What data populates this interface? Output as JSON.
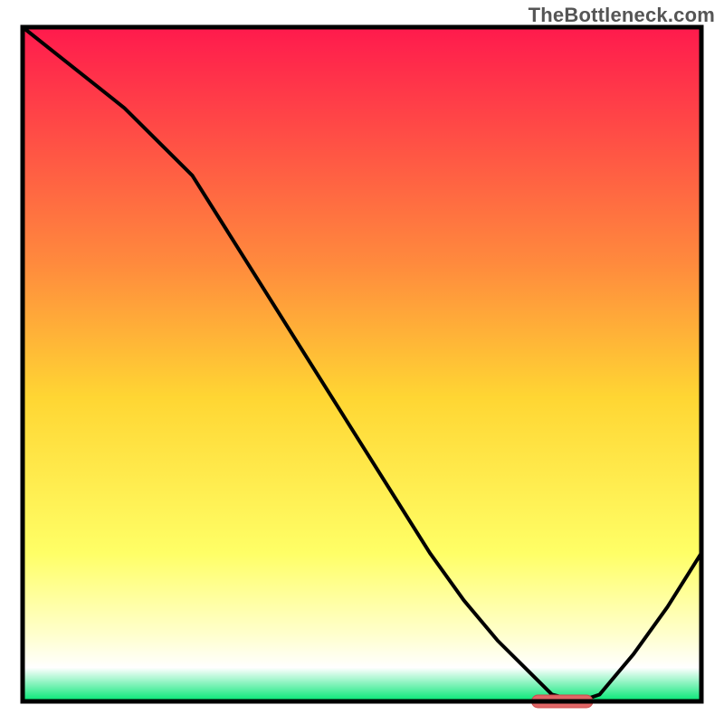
{
  "watermark": "TheBottleneck.com",
  "colors": {
    "border": "#000000",
    "curve": "#000000",
    "marker_fill": "#e06666",
    "marker_stroke": "#cc4b4b",
    "grad_top": "#ff1a4d",
    "grad_upper_mid": "#ff8a3d",
    "grad_mid": "#ffd633",
    "grad_lower_mid": "#ffff66",
    "grad_pale": "#ffffcc",
    "grad_white": "#ffffff",
    "grad_green": "#00e673"
  },
  "chart_data": {
    "type": "line",
    "title": "",
    "xlabel": "",
    "ylabel": "",
    "x": [
      0,
      5,
      10,
      15,
      20,
      25,
      30,
      35,
      40,
      45,
      50,
      55,
      60,
      65,
      70,
      75,
      78,
      82,
      85,
      90,
      95,
      100
    ],
    "values": [
      100,
      96,
      92,
      88,
      83,
      78,
      70,
      62,
      54,
      46,
      38,
      30,
      22,
      15,
      9,
      4,
      1,
      0,
      1,
      7,
      14,
      22
    ],
    "xlim": [
      0,
      100
    ],
    "ylim": [
      0,
      100
    ],
    "marker": {
      "x_start": 75,
      "x_end": 84,
      "y": 0
    }
  }
}
